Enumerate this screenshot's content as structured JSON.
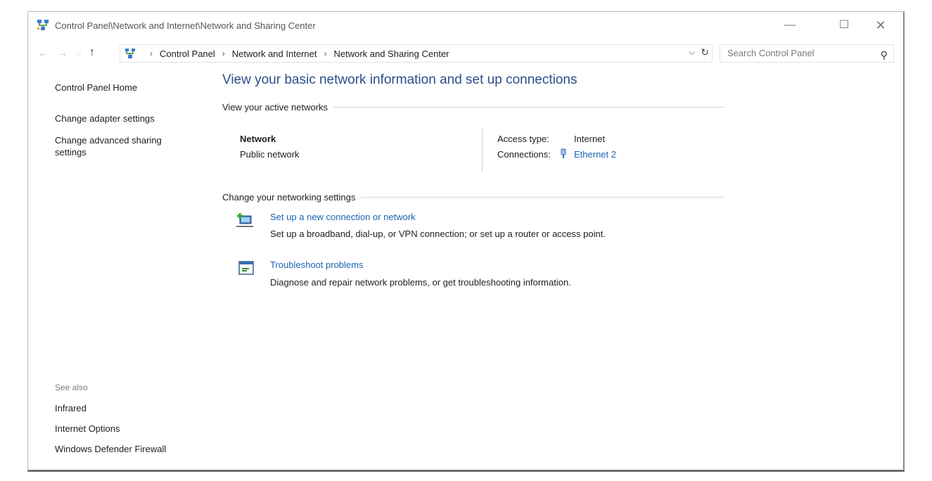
{
  "window": {
    "title": "Control Panel\\Network and Internet\\Network and Sharing Center",
    "minimize_glyph": "—",
    "maximize_glyph": "☐",
    "close_glyph": "✕"
  },
  "nav": {
    "back_glyph": "←",
    "forward_glyph": "→",
    "recent_glyph": "⌵",
    "up_glyph": "↑",
    "breadcrumb": [
      "Control Panel",
      "Network and Internet",
      "Network and Sharing Center"
    ],
    "separator": "›",
    "dropdown_glyph": "⌵",
    "refresh_glyph": "↻",
    "search_placeholder": "Search Control Panel",
    "search_glyph": "⚲"
  },
  "sidebar": {
    "home": "Control Panel Home",
    "adapter": "Change adapter settings",
    "advanced": "Change advanced sharing settings",
    "see_also": "See also",
    "links": [
      "Infrared",
      "Internet Options",
      "Windows Defender Firewall"
    ]
  },
  "main": {
    "title": "View your basic network information and set up connections",
    "active_networks_heading": "View your active networks",
    "network": {
      "name": "Network",
      "type": "Public network",
      "access_label": "Access type:",
      "access_value": "Internet",
      "connections_label": "Connections:",
      "connections_value": "Ethernet 2"
    },
    "change_heading": "Change your networking settings",
    "tasks": [
      {
        "link": "Set up a new connection or network",
        "desc": "Set up a broadband, dial-up, or VPN connection; or set up a router or access point.",
        "icon": "new-connection-icon"
      },
      {
        "link": "Troubleshoot problems",
        "desc": "Diagnose and repair network problems, or get troubleshooting information.",
        "icon": "troubleshoot-icon"
      }
    ]
  },
  "colors": {
    "link": "#1a65b5",
    "title": "#2a4f8a"
  }
}
